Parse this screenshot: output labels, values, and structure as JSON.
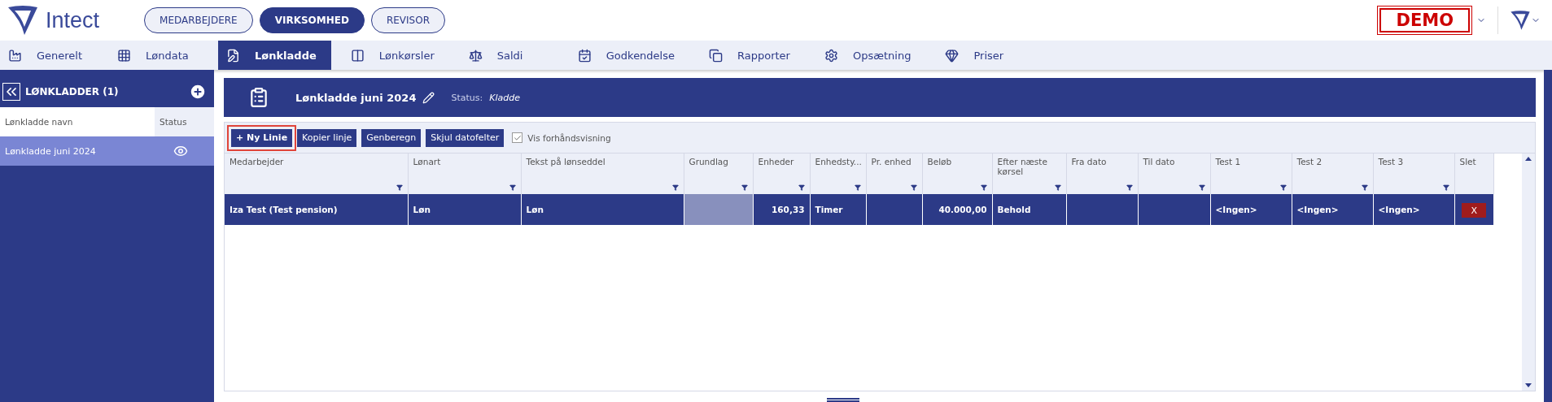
{
  "header": {
    "brand": "Intect",
    "roles": [
      {
        "label": "MEDARBEJDERE",
        "selected": false
      },
      {
        "label": "VIRKSOMHED",
        "selected": true
      },
      {
        "label": "REVISOR",
        "selected": false
      }
    ],
    "badge": "DEMO"
  },
  "nav": [
    {
      "label": "Generelt",
      "selected": false
    },
    {
      "label": "Løndata",
      "selected": false
    },
    {
      "label": "Lønkladde",
      "selected": true
    },
    {
      "label": "Lønkørsler",
      "selected": false
    },
    {
      "label": "Saldi",
      "selected": false
    },
    {
      "label": "Godkendelse",
      "selected": false
    },
    {
      "label": "Rapporter",
      "selected": false
    },
    {
      "label": "Opsætning",
      "selected": false
    },
    {
      "label": "Priser",
      "selected": false
    }
  ],
  "sidebar": {
    "title": "LØNKLADDER (1)",
    "columns": [
      "Lønkladde navn",
      "Status"
    ],
    "items": [
      {
        "name": "Lønkladde juni 2024",
        "selected": true
      }
    ]
  },
  "panel": {
    "title": "Lønkladde juni 2024",
    "status_label": "Status:",
    "status": "Kladde"
  },
  "toolbar": {
    "buttons": [
      {
        "label": "+ Ny Linie",
        "highlighted": true
      },
      {
        "label": "Kopier linje",
        "highlighted": false
      },
      {
        "label": "Genberegn",
        "highlighted": false
      },
      {
        "label": "Skjul datofelter",
        "highlighted": false
      }
    ],
    "preview": {
      "label": "Vis forhåndsvisning",
      "checked": true
    }
  },
  "table": {
    "columns": [
      {
        "label": "Medarbejder",
        "filter": true
      },
      {
        "label": "Lønart",
        "filter": true
      },
      {
        "label": "Tekst på lønseddel",
        "filter": true
      },
      {
        "label": "Grundlag",
        "filter": true
      },
      {
        "label": "Enheder",
        "filter": true
      },
      {
        "label": "Enhedsty...",
        "filter": true
      },
      {
        "label": "Pr. enhed",
        "filter": true
      },
      {
        "label": "Beløb",
        "filter": true
      },
      {
        "label": "Efter næste kørsel",
        "filter": true
      },
      {
        "label": "Fra dato",
        "filter": true
      },
      {
        "label": "Til dato",
        "filter": true
      },
      {
        "label": "Test 1",
        "filter": true
      },
      {
        "label": "Test 2",
        "filter": true
      },
      {
        "label": "Test 3",
        "filter": true
      },
      {
        "label": "Slet",
        "filter": false
      }
    ],
    "rows": [
      {
        "selected": true,
        "delete": "X",
        "cells": [
          {
            "text": "Iza Test (Test pension)",
            "disabled": false
          },
          {
            "text": "Løn",
            "disabled": false
          },
          {
            "text": "Løn",
            "disabled": false
          },
          {
            "text": "",
            "disabled": true
          },
          {
            "text": "160,33",
            "disabled": false
          },
          {
            "text": "Timer",
            "disabled": false
          },
          {
            "text": "",
            "disabled": false
          },
          {
            "text": "40.000,00",
            "disabled": false
          },
          {
            "text": "Behold",
            "disabled": false
          },
          {
            "text": "",
            "disabled": false
          },
          {
            "text": "",
            "disabled": false
          },
          {
            "text": "<Ingen>",
            "disabled": false
          },
          {
            "text": "<Ingen>",
            "disabled": false
          },
          {
            "text": "<Ingen>",
            "disabled": false
          }
        ]
      }
    ]
  }
}
